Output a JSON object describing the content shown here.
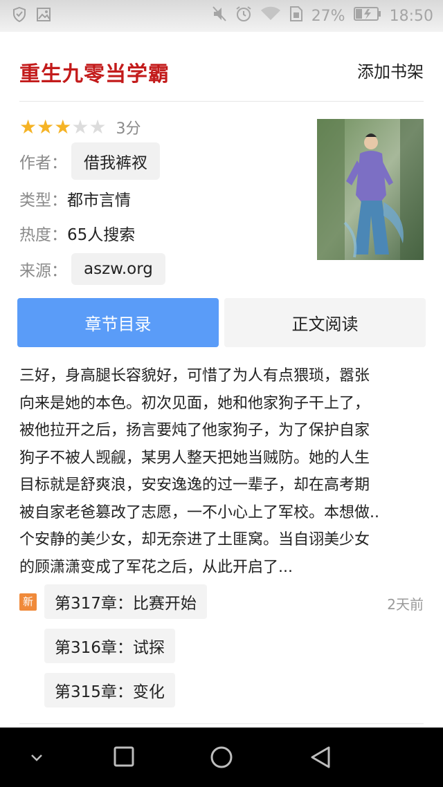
{
  "status_bar": {
    "battery": "27%",
    "time": "18:50",
    "icons": [
      "shield-icon",
      "image-icon",
      "mute-icon",
      "alarm-icon",
      "wifi-icon",
      "sim-icon",
      "battery-charging-icon"
    ]
  },
  "book": {
    "title": "重生九零当学霸",
    "add_shelf": "添加书架",
    "rating_stars": 3,
    "rating_max": 5,
    "score": "3分",
    "author_label": "作者：",
    "author": "借我裤衩",
    "type_label": "类型：",
    "type": "都市言情",
    "heat_label": "热度：",
    "heat": "65人搜索",
    "source_label": "来源：",
    "source": "aszw.org"
  },
  "buttons": {
    "catalog": "章节目录",
    "read": "正文阅读"
  },
  "description_lines": [
    "三好，身高腿长容貌好，可惜了为人有点猥琐，嚣张",
    "向来是她的本色。初次见面，她和他家狗子干上了，",
    "被他拉开之后，扬言要炖了他家狗子，为了保护自家",
    "狗子不被人觊觎，某男人整天把她当贼防。她的人生",
    "目标就是舒爽浪，安安逸逸的过一辈子，却在高考期",
    "被自家老爸篡改了志愿，一不小心上了军校。本想做..",
    "个安静的美少女，却无奈进了土匪窝。当自诩美少女",
    "的顾潇潇变成了军花之后，从此开启了..."
  ],
  "chapters": {
    "new_badge": "新",
    "latest_time": "2天前",
    "items": [
      "第317章：比赛开始",
      "第316章：试探",
      "第315章：变化"
    ]
  }
}
